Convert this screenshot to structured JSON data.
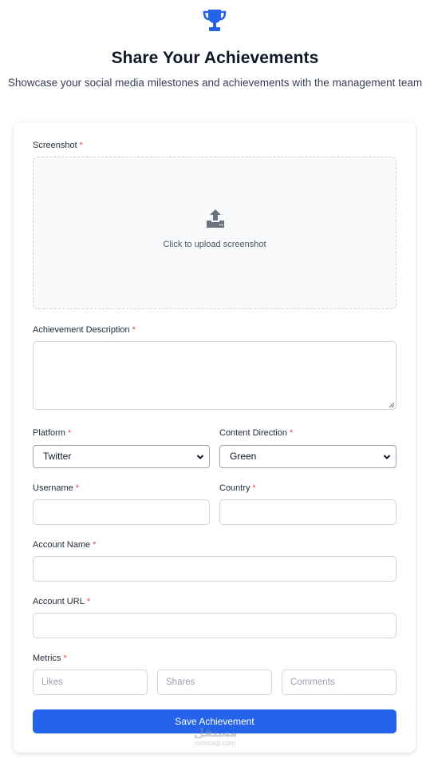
{
  "header": {
    "icon": "trophy-icon",
    "title": "Share Your Achievements",
    "subtitle": "Showcase your social media milestones and achievements with the management team"
  },
  "form": {
    "required_mark": "*",
    "screenshot": {
      "label": "Screenshot",
      "upload_text": "Click to upload screenshot",
      "icon": "upload-icon"
    },
    "description": {
      "label": "Achievement Description",
      "value": ""
    },
    "platform": {
      "label": "Platform",
      "selected": "Twitter"
    },
    "content_direction": {
      "label": "Content Direction",
      "selected": "Green"
    },
    "username": {
      "label": "Username",
      "value": ""
    },
    "country": {
      "label": "Country",
      "value": ""
    },
    "account_name": {
      "label": "Account Name",
      "value": ""
    },
    "account_url": {
      "label": "Account URL",
      "value": ""
    },
    "metrics": {
      "label": "Metrics",
      "likes_placeholder": "Likes",
      "shares_placeholder": "Shares",
      "comments_placeholder": "Comments"
    },
    "save_label": "Save Achievement"
  },
  "watermark": {
    "arabic": "مستقل",
    "latin": "mostaql.com"
  },
  "colors": {
    "primary": "#2563eb",
    "required": "#ef4444",
    "icon_gray": "#6b7280"
  }
}
